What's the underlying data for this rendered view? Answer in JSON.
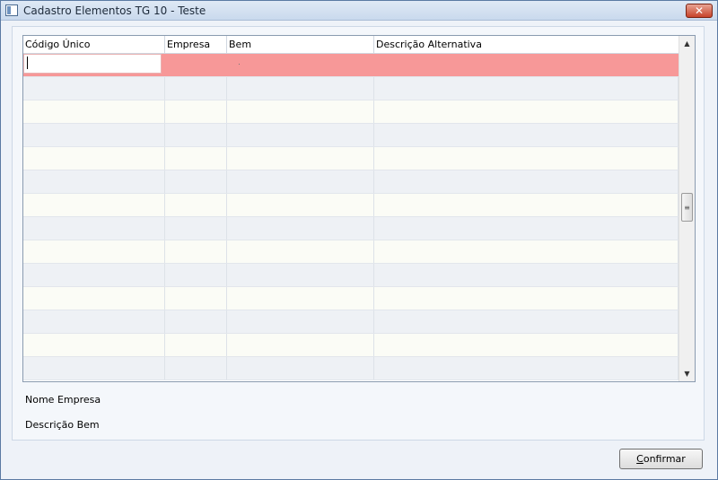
{
  "window": {
    "title": "Cadastro Elementos TG 10 - Teste",
    "close_glyph": "✕"
  },
  "grid": {
    "columns": [
      "Código Único",
      "Empresa",
      "Bem",
      "Descrição Alternativa"
    ],
    "rows": [
      [
        "",
        "",
        "",
        ""
      ],
      [
        "",
        "",
        "",
        ""
      ],
      [
        "",
        "",
        "",
        ""
      ],
      [
        "",
        "",
        "",
        ""
      ],
      [
        "",
        "",
        "",
        ""
      ],
      [
        "",
        "",
        "",
        ""
      ],
      [
        "",
        "",
        "",
        ""
      ],
      [
        "",
        "",
        "",
        ""
      ],
      [
        "",
        "",
        "",
        ""
      ],
      [
        "",
        "",
        "",
        ""
      ],
      [
        "",
        "",
        "",
        ""
      ],
      [
        "",
        "",
        "",
        ""
      ],
      [
        "",
        "",
        "",
        ""
      ],
      [
        "",
        "",
        "",
        ""
      ]
    ],
    "selected_row": 0,
    "scroll_up_glyph": "▲",
    "scroll_down_glyph": "▼",
    "scroll_thumb_glyph": "≡"
  },
  "labels": {
    "nome_empresa": "Nome Empresa",
    "descricao_bem": "Descrição Bem"
  },
  "footer": {
    "confirm_mnemonic": "C",
    "confirm_rest": "onfirmar"
  },
  "colors": {
    "selected_row": "#f79898",
    "close_button": "#c7432a"
  }
}
